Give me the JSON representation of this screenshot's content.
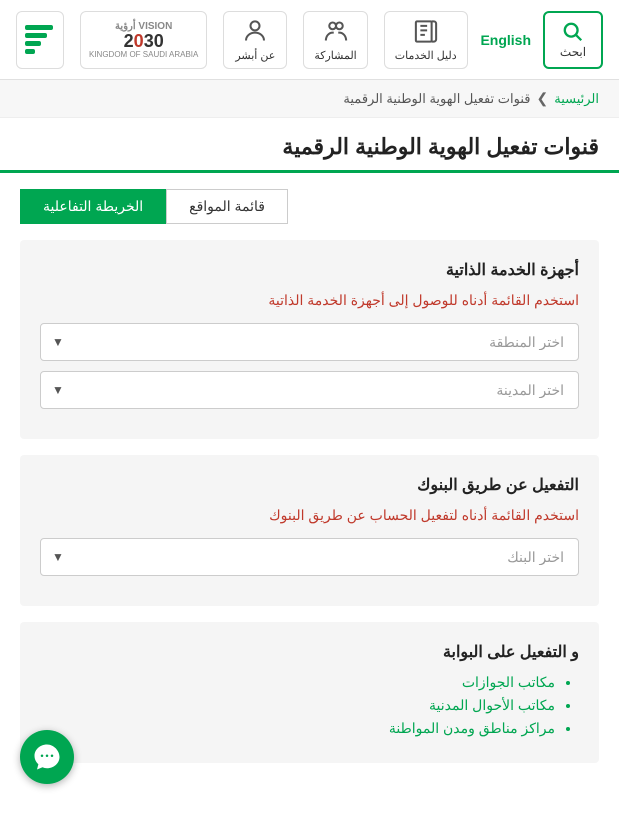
{
  "header": {
    "search_label": "ابحث",
    "english_link": "English",
    "nav_items": [
      {
        "id": "about",
        "label": "عن أبشر",
        "icon": "person-icon"
      },
      {
        "id": "participation",
        "label": "المشاركة",
        "icon": "participation-icon"
      },
      {
        "id": "services_guide",
        "label": "دليل الخدمات",
        "icon": "book-icon"
      }
    ],
    "vision_year": "2030",
    "vision_label": "VISION أرؤية",
    "vision_sub": "KINGDOM OF SAUDI ARABIA"
  },
  "breadcrumb": {
    "home": "الرئيسية",
    "separator": "❯",
    "current": "قنوات تفعيل الهوية الوطنية الرقمية"
  },
  "page": {
    "title": "قنوات تفعيل الهوية الوطنية الرقمية"
  },
  "tabs": [
    {
      "id": "map",
      "label": "الخريطة التفاعلية",
      "active": true
    },
    {
      "id": "list",
      "label": "قائمة المواقع",
      "active": false
    }
  ],
  "sections": [
    {
      "id": "self-service",
      "title": "أجهزة الخدمة الذاتية",
      "desc": "استخدم القائمة أدناه للوصول إلى أجهزة الخدمة الذاتية",
      "dropdowns": [
        {
          "id": "region",
          "placeholder": "اختر المنطقة"
        },
        {
          "id": "city",
          "placeholder": "اختر المدينة"
        }
      ]
    },
    {
      "id": "banks",
      "title": "التفعيل عن طريق البنوك",
      "desc": "استخدم القائمة أدناه لتفعيل الحساب عن طريق البنوك",
      "dropdowns": [
        {
          "id": "bank",
          "placeholder": "اختر البنك"
        }
      ]
    },
    {
      "id": "portal",
      "title": "و التفعيل على البوابة",
      "desc": "",
      "list_items": [
        "مكاتب الجوازات",
        "مكاتب الأحوال المدنية",
        "مراكز مناطق ومدن المواطنة"
      ]
    }
  ],
  "chat": {
    "label": "chat-icon"
  }
}
